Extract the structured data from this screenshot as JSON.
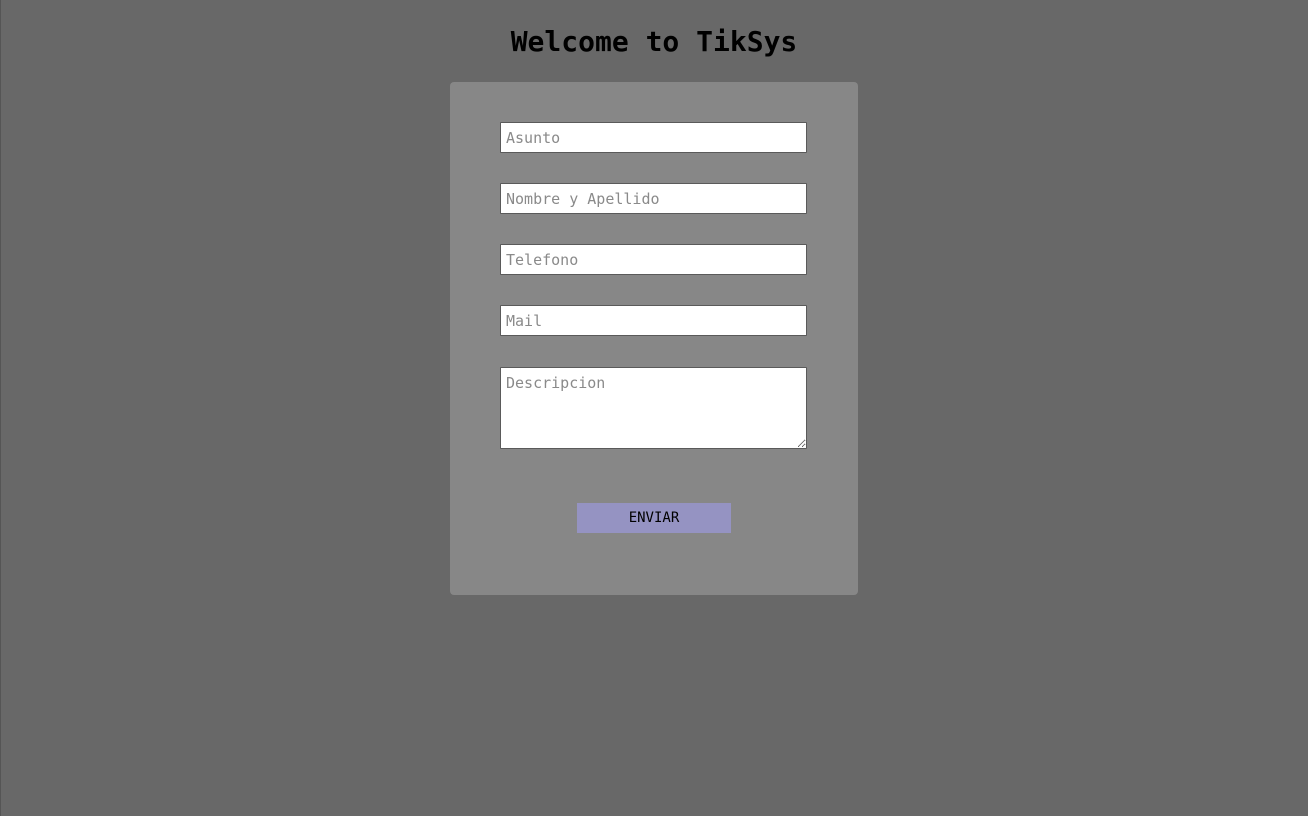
{
  "header": {
    "title": "Welcome to TikSys"
  },
  "form": {
    "fields": [
      {
        "name": "asunto",
        "placeholder": "Asunto",
        "value": ""
      },
      {
        "name": "nombre",
        "placeholder": "Nombre y Apellido",
        "value": ""
      },
      {
        "name": "telefono",
        "placeholder": "Telefono",
        "value": ""
      },
      {
        "name": "mail",
        "placeholder": "Mail",
        "value": ""
      }
    ],
    "description": {
      "placeholder": "Descripcion",
      "value": ""
    },
    "submit_label": "ENVIAR"
  },
  "colors": {
    "background": "#686868",
    "card": "#878787",
    "button": "#9593c2"
  }
}
